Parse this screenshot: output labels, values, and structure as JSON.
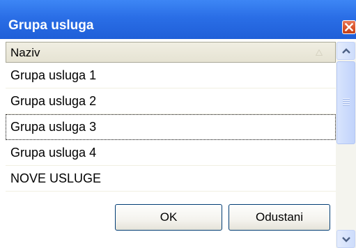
{
  "window": {
    "title": "Grupa usluga"
  },
  "grid": {
    "column_header": "Naziv",
    "rows": [
      {
        "label": "Grupa usluga 1",
        "selected": false
      },
      {
        "label": "Grupa usluga 2",
        "selected": false
      },
      {
        "label": "Grupa usluga 3",
        "selected": true
      },
      {
        "label": "Grupa usluga 4",
        "selected": false
      },
      {
        "label": "NOVE USLUGE",
        "selected": false
      }
    ]
  },
  "buttons": {
    "ok_label": "OK",
    "cancel_label": "Odustani"
  },
  "icons": {
    "close": "close-icon",
    "sort": "sort-ascending-icon",
    "scroll_up": "chevron-up-icon",
    "scroll_down": "chevron-down-icon"
  },
  "colors": {
    "titlebar": "#2a6ee6",
    "close_button": "#d9532a",
    "header": "#ebe9da",
    "button_border": "#003c74"
  }
}
